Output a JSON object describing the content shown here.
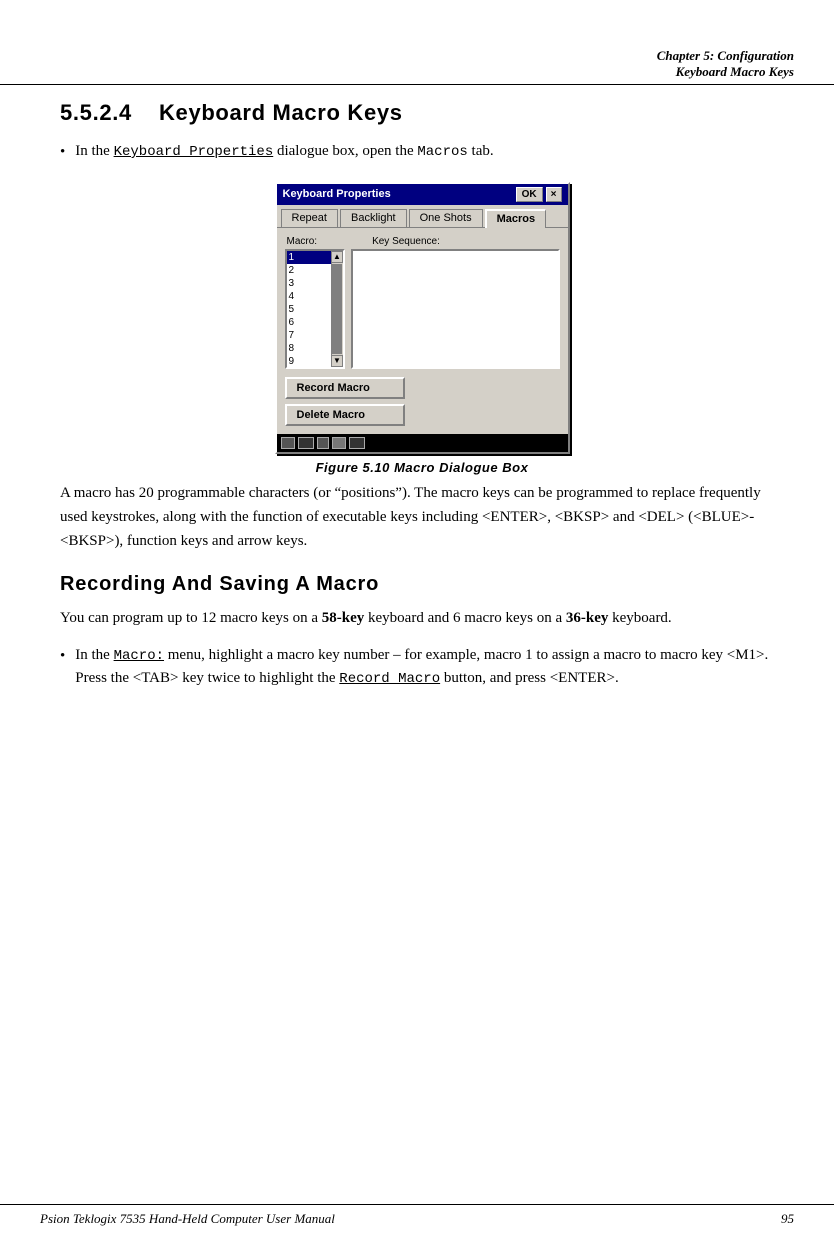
{
  "header": {
    "chapter": "Chapter  5:  Configuration",
    "section": "Keyboard Macro Keys"
  },
  "section": {
    "number": "5.5.2.4",
    "title": "Keyboard  Macro  Keys"
  },
  "intro_bullet": "In the",
  "intro_kbd_ref": "Keyboard Properties",
  "intro_text1": "dialogue box, open the",
  "intro_tab_ref": "Macros",
  "intro_text2": "tab.",
  "dialog": {
    "title": "Keyboard Properties",
    "ok_label": "OK",
    "close_label": "×",
    "tabs": [
      {
        "label": "Repeat",
        "active": false
      },
      {
        "label": "Backlight",
        "active": false
      },
      {
        "label": "One Shots",
        "active": false
      },
      {
        "label": "Macros",
        "active": true
      }
    ],
    "macro_label": "Macro:",
    "keyseq_label": "Key Sequence:",
    "macro_items": [
      "1",
      "2",
      "3",
      "4",
      "5",
      "6",
      "7",
      "8",
      "9"
    ],
    "selected_macro": "1",
    "buttons": {
      "record": "Record Macro",
      "delete": "Delete Macro"
    }
  },
  "figure_caption": "Figure  5.10  Macro  Dialogue  Box",
  "body_para1": "A macro has 20 programmable characters (or “positions”). The macro keys can be programmed to replace frequently used keystrokes, along with the function of executable keys including <ENTER>, <BKSP> and <DEL> (<BLUE>-<BKSP>), function keys and arrow keys.",
  "subheading": "Recording  And  Saving  A  Macro",
  "body_para2_pre": "You can program up to 12 macro keys on a",
  "body_para2_58key": "58-key",
  "body_para2_mid": "keyboard and 6 macro keys on a",
  "body_para2_36key": "36-key",
  "body_para2_post": "keyboard.",
  "bullet2_pre": "In the",
  "bullet2_macro_ref": "Macro:",
  "bullet2_text": "menu, highlight a macro key number – for example, macro 1  to assign a macro to macro key <M1>. Press the <TAB> key twice to highlight the",
  "bullet2_record_ref": "Record Macro",
  "bullet2_end": "button, and press <ENTER>.",
  "footer": {
    "left": "Psion Teklogix 7535 Hand-Held Computer User Manual",
    "right": "95"
  }
}
